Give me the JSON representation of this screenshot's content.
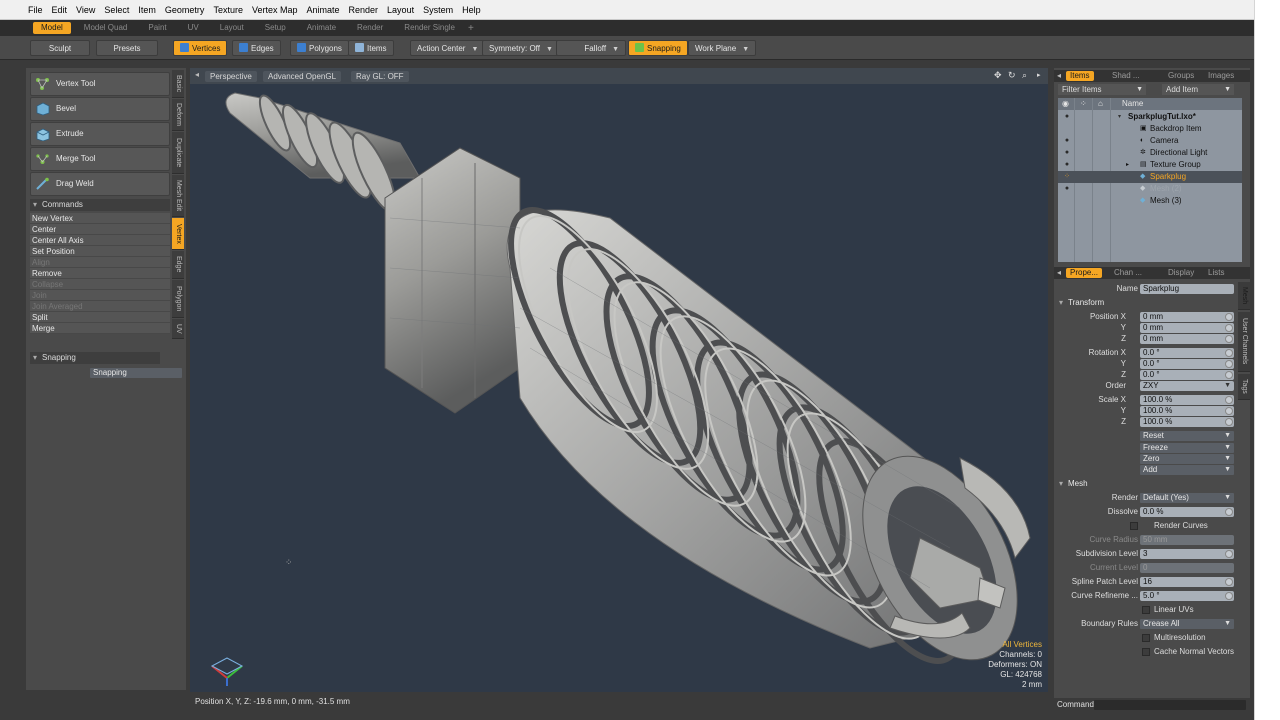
{
  "menubar": {
    "items": [
      "File",
      "Edit",
      "View",
      "Select",
      "Item",
      "Geometry",
      "Texture",
      "Vertex Map",
      "Animate",
      "Render",
      "Layout",
      "System",
      "Help"
    ]
  },
  "tabs": {
    "items": [
      "Model",
      "Model Quad",
      "Paint",
      "UV",
      "Layout",
      "Setup",
      "Animate",
      "Render",
      "Render Single"
    ],
    "active_index": 0,
    "plus": "+"
  },
  "toolbar": {
    "sculpt": "Sculpt",
    "presets": "Presets",
    "vertices": "Vertices",
    "edges": "Edges",
    "polygons": "Polygons",
    "items": "Items",
    "action_center": "Action Center",
    "symmetry": "Symmetry: Off",
    "falloff": "Falloff",
    "snapping": "Snapping",
    "work_plane": "Work Plane",
    "accent": "#f5a623"
  },
  "left_tools": {
    "tools": [
      {
        "label": "Vertex Tool",
        "icon": "vertex-tool-icon"
      },
      {
        "label": "Bevel",
        "icon": "bevel-icon"
      },
      {
        "label": "Extrude",
        "icon": "extrude-icon"
      },
      {
        "label": "Merge Tool",
        "icon": "merge-tool-icon"
      },
      {
        "label": "Drag Weld",
        "icon": "drag-weld-icon"
      }
    ],
    "commands_title": "Commands",
    "commands": [
      {
        "label": "New Vertex",
        "enabled": true
      },
      {
        "label": "Center",
        "enabled": true
      },
      {
        "label": "Center All Axis",
        "enabled": true
      },
      {
        "label": "Set Position",
        "enabled": true
      },
      {
        "label": "Align",
        "enabled": false
      },
      {
        "label": "Remove",
        "enabled": true
      },
      {
        "label": "Collapse",
        "enabled": false
      },
      {
        "label": "Join",
        "enabled": false
      },
      {
        "label": "Join Averaged",
        "enabled": false
      },
      {
        "label": "Split",
        "enabled": true
      },
      {
        "label": "Merge",
        "enabled": true
      }
    ],
    "snapping_title": "Snapping",
    "snapping_button": "Snapping",
    "vertical_tabs": [
      "Basic",
      "Deform",
      "Duplicate",
      "Mesh Edit",
      "Vertex",
      "Edge",
      "Polygon",
      "UV"
    ],
    "vertical_active": "Vertex"
  },
  "viewport": {
    "view_mode": "Perspective",
    "shading": "Advanced OpenGL",
    "raygl": "Ray GL: OFF",
    "stats": {
      "selection": "All Vertices",
      "channels": "Channels: 0",
      "deformers": "Deformers: ON",
      "gl": "GL: 424768",
      "scale": "2 mm"
    },
    "background": "#2f3947"
  },
  "statusbar": {
    "position": "Position X, Y, Z:   -19.6 mm, 0 mm, -31.5 mm"
  },
  "command_bar": {
    "label": "Command"
  },
  "items_panel": {
    "tabs": [
      "Items",
      "Shad ...",
      "Groups",
      "Images"
    ],
    "active_tab": "Items",
    "filter": "Filter Items",
    "add_item": "Add Item",
    "column_name": "Name",
    "rows": [
      {
        "label": "SparkplugTut.lxo*",
        "indent": 0,
        "eye": "●",
        "selected": false,
        "faded": false
      },
      {
        "label": "Backdrop Item",
        "indent": 1,
        "eye": "",
        "selected": false,
        "faded": false
      },
      {
        "label": "Camera",
        "indent": 1,
        "eye": "●",
        "selected": false,
        "faded": false
      },
      {
        "label": "Directional Light",
        "indent": 1,
        "eye": "●",
        "selected": false,
        "faded": false
      },
      {
        "label": "Texture Group",
        "indent": 1,
        "eye": "●",
        "selected": false,
        "faded": false
      },
      {
        "label": "Sparkplug",
        "indent": 1,
        "eye": "⁘",
        "selected": true,
        "faded": false
      },
      {
        "label": "Mesh (2)",
        "indent": 1,
        "eye": "●",
        "selected": false,
        "faded": true
      },
      {
        "label": "Mesh (3)",
        "indent": 1,
        "eye": "",
        "selected": false,
        "faded": false
      }
    ]
  },
  "properties_panel": {
    "tabs": [
      "Prope...",
      "Chan ...",
      "Display",
      "Lists"
    ],
    "active_tab": "Prope...",
    "side_tabs": [
      "Mesh",
      "User Channels",
      "Tags"
    ],
    "name_label": "Name",
    "name_value": "Sparkplug",
    "transform_title": "Transform",
    "position_label": "Position X",
    "position": [
      "0 mm",
      "0 mm",
      "0 mm"
    ],
    "rotation_label": "Rotation X",
    "rotation": [
      "0.0 °",
      "0.0 °",
      "0.0 °"
    ],
    "axis_y": "Y",
    "axis_z": "Z",
    "order_label": "Order",
    "order_value": "ZXY",
    "scale_label": "Scale X",
    "scale": [
      "100.0 %",
      "100.0 %",
      "100.0 %"
    ],
    "transform_buttons": [
      "Reset",
      "Freeze",
      "Zero",
      "Add"
    ],
    "mesh_title": "Mesh",
    "render_label": "Render",
    "render_value": "Default (Yes)",
    "dissolve_label": "Dissolve",
    "dissolve_value": "0.0 %",
    "render_curves": "Render Curves",
    "curve_radius_label": "Curve Radius",
    "curve_radius_value": "50 mm",
    "subdiv_label": "Subdivision Level",
    "subdiv_value": "3",
    "current_level_label": "Current Level",
    "current_level_value": "0",
    "spline_label": "Spline Patch Level",
    "spline_value": "16",
    "curve_refine_label": "Curve Refineme ...",
    "curve_refine_value": "5.0 °",
    "linear_uvs": "Linear UVs",
    "boundary_label": "Boundary Rules",
    "boundary_value": "Crease All",
    "multires": "Multiresolution",
    "cache_normal": "Cache Normal Vectors"
  }
}
